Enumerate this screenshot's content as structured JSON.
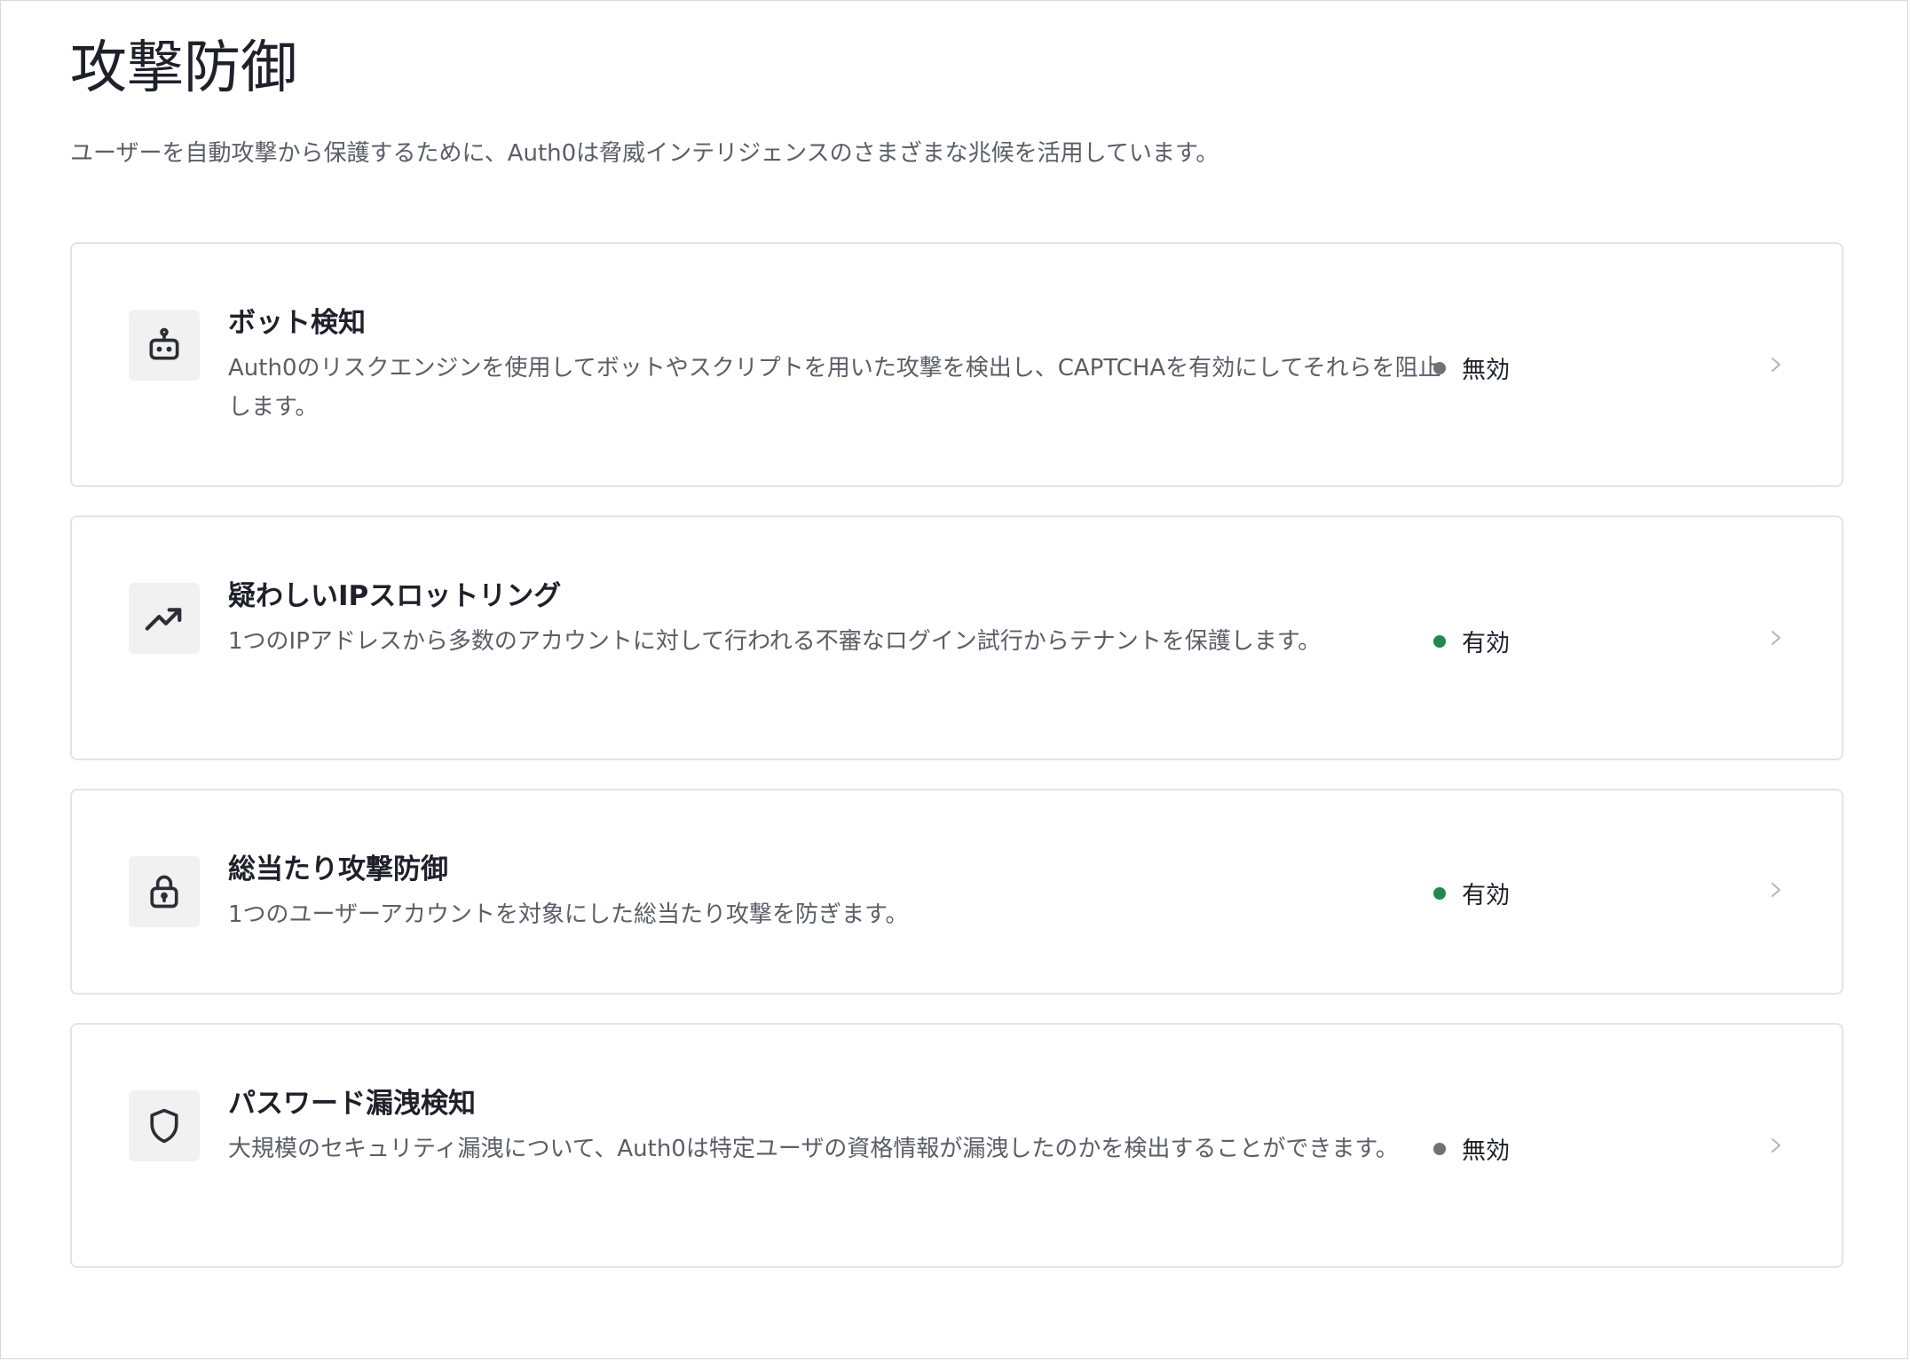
{
  "page": {
    "title": "攻撃防御",
    "description": "ユーザーを自動攻撃から保護するために、Auth0は脅威インテリジェンスのさまざまな兆候を活用しています。"
  },
  "colors": {
    "enabled": "#1f8a4c",
    "disabled": "#6f7278"
  },
  "cards": [
    {
      "icon": "robot-icon",
      "title": "ボット検知",
      "description": "Auth0のリスクエンジンを使用してボットやスクリプトを用いた攻撃を検出し、CAPTCHAを有効にしてそれらを阻止します。",
      "status": "無効",
      "enabled": false
    },
    {
      "icon": "trending-up-icon",
      "title": "疑わしいIPスロットリング",
      "description": "1つのIPアドレスから多数のアカウントに対して行われる不審なログイン試行からテナントを保護します。",
      "status": "有効",
      "enabled": true
    },
    {
      "icon": "lock-icon",
      "title": "総当たり攻撃防御",
      "description": "1つのユーザーアカウントを対象にした総当たり攻撃を防ぎます。",
      "status": "有効",
      "enabled": true
    },
    {
      "icon": "shield-icon",
      "title": "パスワード漏洩検知",
      "description": "大規模のセキュリティ漏洩について、Auth0は特定ユーザの資格情報が漏洩したのかを検出することができます。",
      "status": "無効",
      "enabled": false
    }
  ]
}
